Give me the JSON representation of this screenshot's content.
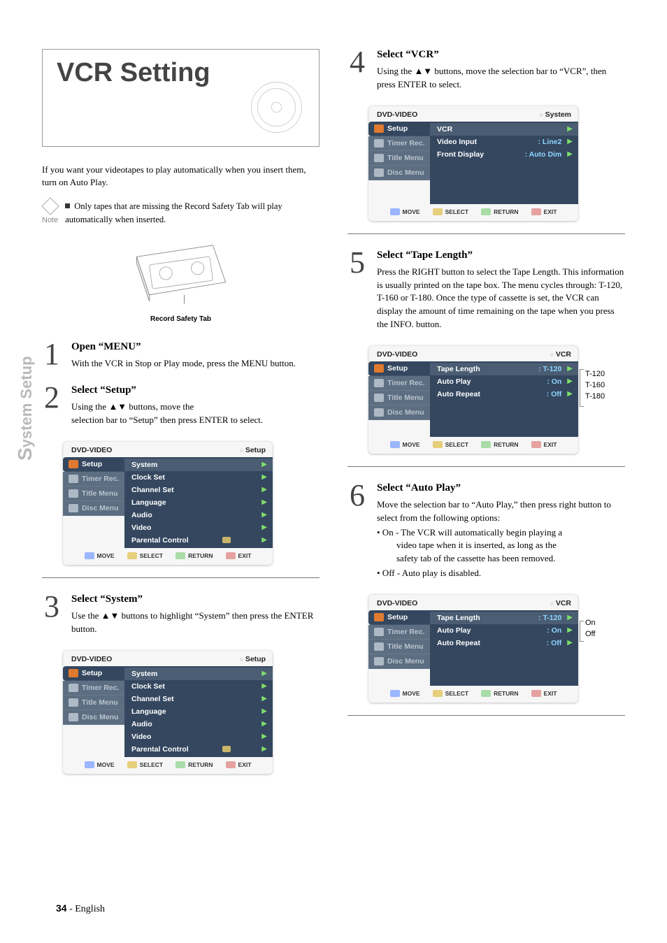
{
  "side_tab_cap": "S",
  "side_tab_rest": "ystem Setup",
  "title": "VCR Setting",
  "intro": "If you want your videotapes to play automatically when you insert them, turn on Auto Play.",
  "note_label": "Note",
  "note_text": "Only tapes that are missing the Record Safety  Tab will play automatically when inserted.",
  "cassette_caption": "Record Safety Tab",
  "steps": {
    "s1": {
      "num": "1",
      "title": "Open “MENU”",
      "text": "With the VCR in Stop or Play mode, press the MENU button."
    },
    "s2": {
      "num": "2",
      "title": "Select “Setup”",
      "line1": "Using the  ▲▼   buttons, move the",
      "line2": "selection bar to “Setup” then press ENTER to select."
    },
    "s3": {
      "num": "3",
      "title": "Select “System”",
      "text": "Use the ▲▼ buttons to highlight “System” then press the ENTER button."
    },
    "s4": {
      "num": "4",
      "title": "Select “VCR”",
      "text": "Using the ▲▼ buttons, move the selection bar to “VCR”, then press ENTER to select."
    },
    "s5": {
      "num": "5",
      "title": "Select “Tape Length”",
      "text": "Press the RIGHT button to select the Tape Length. This information is usually printed on the tape box. The menu cycles through: T-120, T-160 or T-180. Once the type of cassette is set, the VCR can display the amount of time remaining on the tape when you press the INFO. button."
    },
    "s6": {
      "num": "6",
      "title": "Select “Auto Play”",
      "intro": "Move the selection bar to “Auto Play,” then press right button to select from the following options:",
      "b1": "• On - The VCR will automatically begin playing a",
      "b1b": "video tape when it is inserted, as long as the",
      "b1c": "safety tab of the cassette has been removed.",
      "b2": "• Off - Auto play is disabled."
    }
  },
  "osd_common": {
    "hdr": "DVD-VIDEO",
    "side": {
      "setup": "Setup",
      "timer": "Timer Rec.",
      "title": "Title Menu",
      "disc": "Disc Menu"
    },
    "ftr": {
      "move": "MOVE",
      "select": "SELECT",
      "return": "RETURN",
      "exit": "EXIT"
    }
  },
  "osd_setup": {
    "crumb": "Setup",
    "rows": {
      "system": "System",
      "clock": "Clock Set",
      "channel": "Channel Set",
      "language": "Language",
      "audio": "Audio",
      "video": "Video",
      "parental": "Parental Control"
    }
  },
  "osd_system": {
    "crumb": "System",
    "rows": {
      "vcr": {
        "label": "VCR"
      },
      "video_input": {
        "label": "Video Input",
        "val": ": Line2"
      },
      "front": {
        "label": "Front Display",
        "val": ": Auto Dim"
      }
    }
  },
  "osd_vcr": {
    "crumb": "VCR",
    "rows": {
      "tape": {
        "label": "Tape Length",
        "val": ": T-120"
      },
      "autoplay": {
        "label": "Auto Play",
        "val": ": On"
      },
      "autorepeat": {
        "label": "Auto Repeat",
        "val": ": Off"
      }
    }
  },
  "annot_tape": {
    "a": "T-120",
    "b": "T-160",
    "c": "T-180"
  },
  "annot_auto": {
    "a": "On",
    "b": "Off"
  },
  "footer": {
    "num": "34",
    "dash": " - ",
    "lang": "English"
  }
}
